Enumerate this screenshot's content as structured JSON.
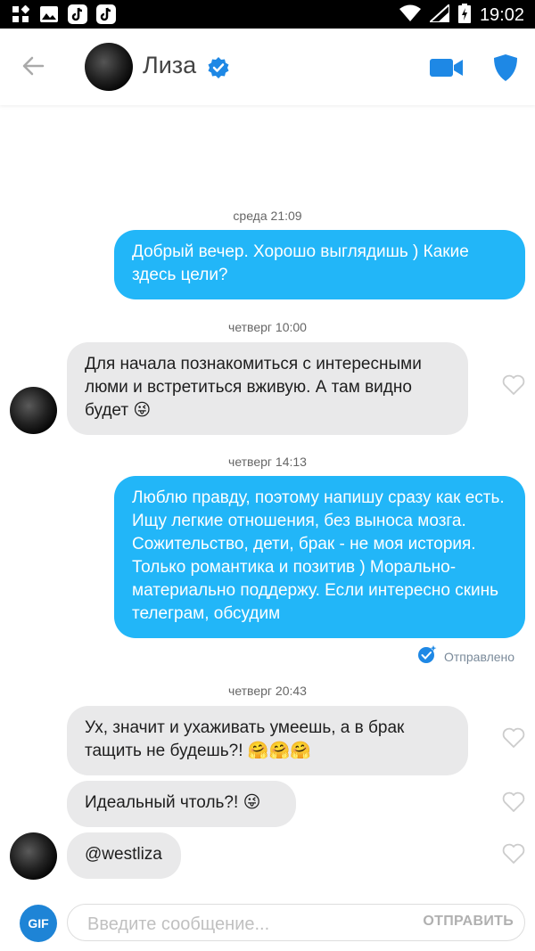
{
  "status_bar": {
    "time": "19:02",
    "left_icons": [
      "apps-grid-icon",
      "image-icon",
      "tiktok-icon",
      "tiktok-icon"
    ],
    "right_icons": [
      "wifi-icon",
      "signal-icon",
      "battery-charging-icon"
    ]
  },
  "header": {
    "contact_name": "Лиза",
    "icons": [
      "back-arrow-icon",
      "verified-badge-icon",
      "video-call-icon",
      "shield-icon"
    ],
    "accent_color": "#1e88e5"
  },
  "messages": [
    {
      "type": "timestamp",
      "text": "среда 21:09"
    },
    {
      "type": "outgoing",
      "text": "Добрый вечер. Хорошо выглядишь ) Какие здесь цели?"
    },
    {
      "type": "timestamp",
      "text": "четверг 10:00"
    },
    {
      "type": "incoming",
      "text": "Для начала познакомиться с интересными люми и встретиться вживую. А там видно будет",
      "emoji": "😜"
    },
    {
      "type": "timestamp",
      "text": "четверг 14:13"
    },
    {
      "type": "outgoing",
      "text": "Люблю правду, поэтому напишу сразу как есть. Ищу легкие отношения, без выноса мозга. Сожительство, дети, брак - не моя история. Только романтика и позитив ) Морально-материально поддержу. Если интересно скинь телеграм, обсудим"
    },
    {
      "type": "status",
      "text": "Отправлено"
    },
    {
      "type": "timestamp",
      "text": "четверг 20:43"
    },
    {
      "type": "incoming",
      "text": "Ух, значит и ухаживать умеешь, а в брак тащить не будешь?!",
      "emoji": "🤗🤗🤗"
    },
    {
      "type": "incoming",
      "text": "Идеальный чтоль?!",
      "emoji": "😜"
    },
    {
      "type": "incoming",
      "text": "@westliza"
    }
  ],
  "composer": {
    "gif_label": "GIF",
    "placeholder": "Введите сообщение...",
    "send_label": "ОТПРАВИТЬ"
  },
  "colors": {
    "outgoing_bubble": "#22b6f8",
    "incoming_bubble": "#e9e9ea",
    "gif_button": "#1e84d6"
  }
}
